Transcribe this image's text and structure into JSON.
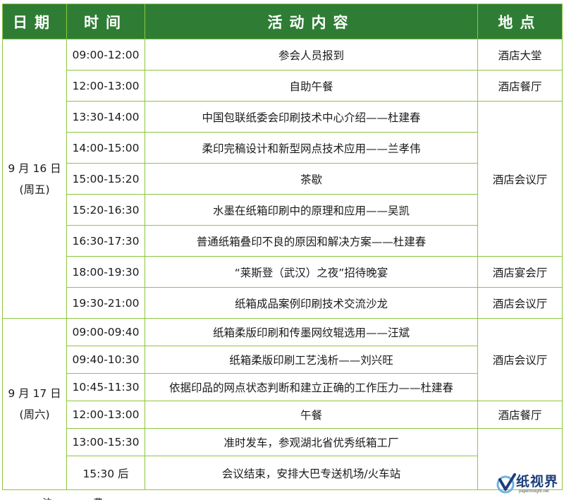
{
  "header": {
    "date": "日期",
    "time": "时间",
    "activity": "活动内容",
    "venue": "地点"
  },
  "days": [
    {
      "date": "9 月 16 日",
      "weekday": "(周五)"
    },
    {
      "date": "9 月 17 日",
      "weekday": "(周六)"
    }
  ],
  "rows": [
    {
      "time": "09:00-12:00",
      "activity": "参会人员报到",
      "venue": "酒店大堂"
    },
    {
      "time": "12:00-13:00",
      "activity": "自助午餐",
      "venue": "酒店餐厅"
    },
    {
      "time": "13:30-14:00",
      "activity": "中国包联纸委会印刷技术中心介绍——杜建春",
      "venue": "酒店会议厅"
    },
    {
      "time": "14:00-15:00",
      "activity": "柔印完稿设计和新型网点技术应用——兰孝伟",
      "venue": ""
    },
    {
      "time": "15:00-15:20",
      "activity": "茶歇",
      "venue": ""
    },
    {
      "time": "15:20-16:30",
      "activity": "水墨在纸箱印刷中的原理和应用——吴凯",
      "venue": ""
    },
    {
      "time": "16:30-17:30",
      "activity": "普通纸箱叠印不良的原因和解决方案——杜建春",
      "venue": ""
    },
    {
      "time": "18:00-19:30",
      "activity": "“莱斯登（武汉）之夜”招待晚宴",
      "venue": "酒店宴会厅"
    },
    {
      "time": "19:30-21:00",
      "activity": "纸箱成品案例印刷技术交流沙龙",
      "venue": "酒店会议厅"
    },
    {
      "time": "09:00-09:40",
      "activity": "纸箱柔版印刷和传墨网纹辊选用——汪斌",
      "venue": "酒店会议厅"
    },
    {
      "time": "09:40-10:30",
      "activity": "纸箱柔版印刷工艺浅析——刘兴旺",
      "venue": ""
    },
    {
      "time": "10:45-11:30",
      "activity": "依据印品的网点状态判断和建立正确的工作压力——杜建春",
      "venue": ""
    },
    {
      "time": "12:00-13:00",
      "activity": "午餐",
      "venue": "酒店餐厅"
    },
    {
      "time": "13:00-15:30",
      "activity": "准时发车，参观湖北省优秀纸箱工厂",
      "venue": ""
    },
    {
      "time": "15:30 后",
      "activity": "会议结束，安排大巴专送机场/火车站",
      "venue": ""
    }
  ],
  "watermark": {
    "brand": "纸视界",
    "url": "paperinsight.net"
  },
  "colors": {
    "header_bg": "#2f7d34",
    "border": "#8dc63f"
  }
}
